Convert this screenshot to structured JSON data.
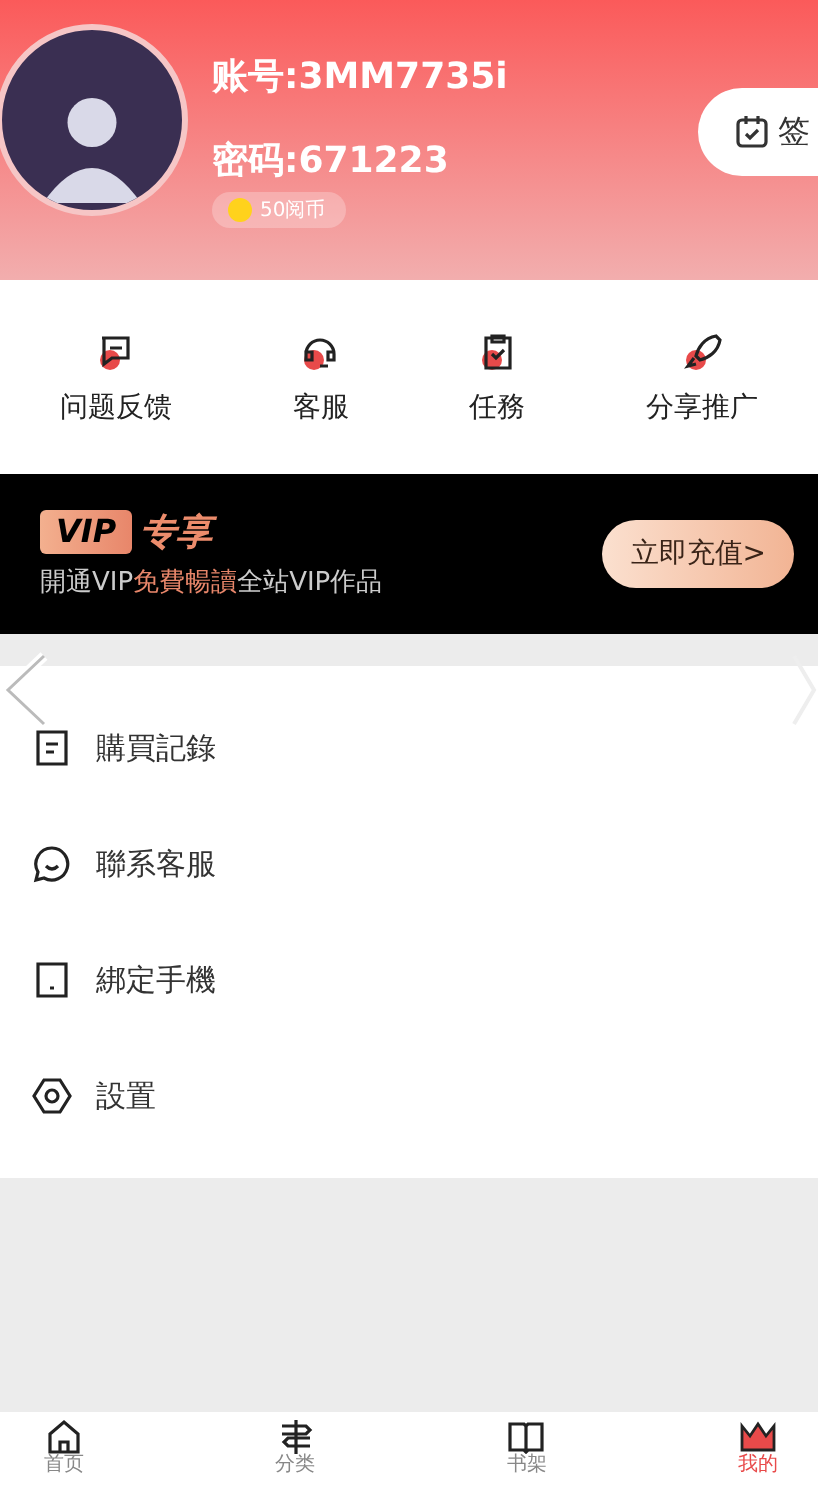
{
  "profile": {
    "account": "账号:3MM7735i",
    "password": "密码:671223",
    "coins": "50阅币",
    "sign_in": "签"
  },
  "shortcuts": [
    {
      "label": "问题反馈",
      "kind": "feedback"
    },
    {
      "label": "客服",
      "kind": "service"
    },
    {
      "label": "任務",
      "kind": "task"
    },
    {
      "label": "分享推广",
      "kind": "share"
    }
  ],
  "vip": {
    "badge": "VIP",
    "title": "专享",
    "text_before": "開通VIP",
    "text_highlight": "免費暢讀",
    "text_after": "全站VIP作品",
    "button": "立即充值>"
  },
  "menu": [
    {
      "label": "購買記錄",
      "kind": "record"
    },
    {
      "label": "聯系客服",
      "kind": "chat"
    },
    {
      "label": "綁定手機",
      "kind": "phone"
    },
    {
      "label": "設置",
      "kind": "settings"
    }
  ],
  "nav": [
    {
      "label": "首页",
      "kind": "home",
      "selected": false
    },
    {
      "label": "分类",
      "kind": "sign",
      "selected": false
    },
    {
      "label": "书架",
      "kind": "book",
      "selected": false
    },
    {
      "label": "我的",
      "kind": "crown",
      "selected": true
    }
  ]
}
